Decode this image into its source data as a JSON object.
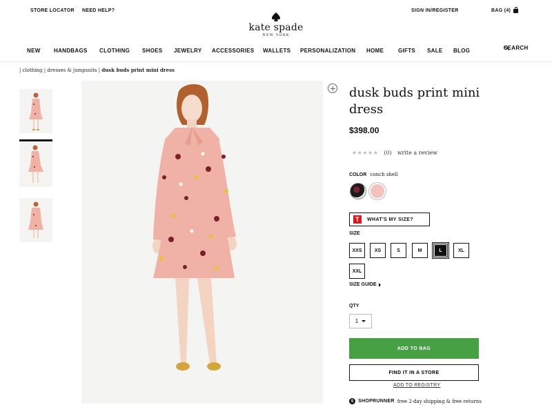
{
  "header": {
    "store_locator": "STORE LOCATOR",
    "need_help": "NEED HELP?",
    "sign_in": "SIGN IN/REGISTER",
    "bag": "BAG (4)",
    "logo_name": "kate spade",
    "logo_sub": "NEW YORK"
  },
  "nav": {
    "items": [
      "NEW",
      "HANDBAGS",
      "CLOTHING",
      "SHOES",
      "JEWELRY",
      "ACCESSORIES",
      "WALLETS",
      "PERSONALIZATION",
      "HOME",
      "GIFTS",
      "SALE",
      "BLOG"
    ],
    "search": "SEARCH"
  },
  "breadcrumb": {
    "items": [
      "clothing",
      "dresses & jumpsuits"
    ],
    "current": "dusk buds print mini dress"
  },
  "product": {
    "title": "dusk buds print mini dress",
    "price": "$398.00",
    "rating_stars": "★★★★★",
    "review_count": "(0)",
    "write_review": "write a review",
    "color_label": "COLOR",
    "color_value": "conch shell",
    "whats_my_size": "WHAT'S MY SIZE?",
    "t_icon_letter": "T",
    "size_label": "SIZE",
    "sizes": [
      "XXS",
      "XS",
      "S",
      "M",
      "L",
      "XL",
      "XXL"
    ],
    "selected_size": "L",
    "size_guide": "SIZE GUIDE",
    "qty_label": "QTY",
    "qty_value": "1",
    "add_to_bag": "ADD TO BAG",
    "find_in_store": "FIND IT IN A STORE",
    "add_to_registry": "ADD TO REGISTRY",
    "shoprunner_name": "SHOPRUNNER",
    "shoprunner_text": "free 2-day shipping & free returns"
  },
  "colors": {
    "add_to_bag_bg": "#48a045",
    "dress_pink": "#f0b2a6",
    "swatch_conch_shell": "#f3c2bd",
    "target_red": "#d71920"
  }
}
